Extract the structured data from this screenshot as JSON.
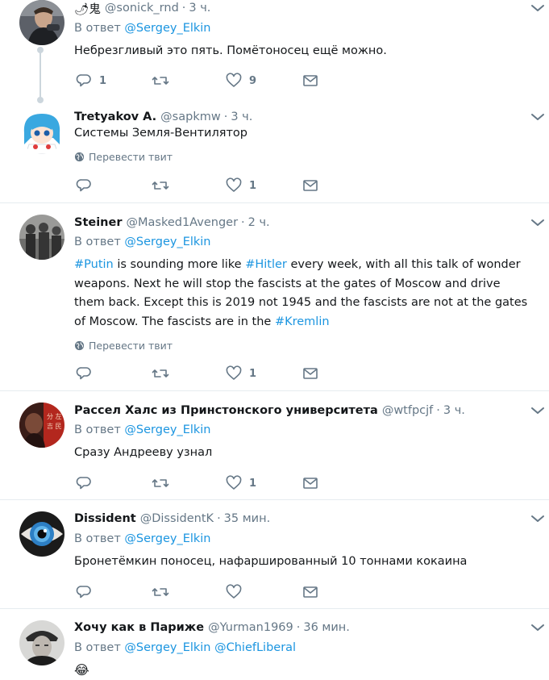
{
  "tweets": [
    {
      "name": "",
      "emoji": "🌶鬼",
      "handle": "@sonick_rnd",
      "time": "3 ч.",
      "reply_label": "В ответ",
      "reply_mentions": [
        "@Sergey_Elkin"
      ],
      "text": "Небрезгливый это пять. Помётоносец ещё можно.",
      "replies": "1",
      "retweets": "",
      "likes": "9"
    },
    {
      "name": "Tretyakov A.",
      "handle": "@sapkmw",
      "time": "3 ч.",
      "text": "Системы Земля-Вентилятор",
      "translate": "Перевести твит",
      "replies": "",
      "retweets": "",
      "likes": "1"
    },
    {
      "name": "Steiner",
      "handle": "@Masked1Avenger",
      "time": "2 ч.",
      "reply_label": "В ответ",
      "reply_mentions": [
        "@Sergey_Elkin"
      ],
      "text_parts": [
        {
          "t": "#Putin",
          "tag": true
        },
        {
          "t": " is sounding more like ",
          "tag": false
        },
        {
          "t": "#Hitler",
          "tag": true
        },
        {
          "t": " every week, with all this talk of wonder weapons. Next he will stop the fascists at the gates of Moscow and drive them back. Except this is 2019 not 1945 and the fascists are not at the gates of Moscow. The fascists are in the ",
          "tag": false
        },
        {
          "t": "#Kremlin",
          "tag": true
        }
      ],
      "translate": "Перевести твит",
      "replies": "",
      "retweets": "",
      "likes": "1"
    },
    {
      "name": "Рассел Халс из Принстонского университета",
      "handle": "@wtfpcjf",
      "time": "3 ч.",
      "reply_label": "В ответ",
      "reply_mentions": [
        "@Sergey_Elkin"
      ],
      "text": "Сразу Андрееву узнал",
      "replies": "",
      "retweets": "",
      "likes": "1"
    },
    {
      "name": "Dissident",
      "handle": "@DissidentK",
      "time": "35 мин.",
      "reply_label": "В ответ",
      "reply_mentions": [
        "@Sergey_Elkin"
      ],
      "text": "Бронетёмкин поносец, нафаршированный 10 тоннами кокаина",
      "replies": "",
      "retweets": "",
      "likes": ""
    },
    {
      "name": "Хочу как в Париже",
      "handle": "@Yurman1969",
      "time": "36 мин.",
      "reply_label": "В ответ",
      "reply_mentions": [
        "@Sergey_Elkin",
        "@ChiefLiberal"
      ],
      "text": "😂",
      "replies": "",
      "retweets": "",
      "likes": ""
    }
  ],
  "avatar_art": [
    "avatar-photo-man",
    "avatar-anime-girl",
    "avatar-soldiers-photo",
    "avatar-red-poster",
    "avatar-blue-eye",
    "avatar-man-cap"
  ],
  "icons": {
    "reply": "reply-icon",
    "retweet": "retweet-icon",
    "like": "heart-icon",
    "dm": "envelope-icon",
    "menu": "chevron-down-icon",
    "globe": "globe-icon"
  },
  "colors": {
    "link": "#1b95e0",
    "muted": "#657786",
    "separator": "#e6ecf0",
    "text": "#14171a"
  }
}
